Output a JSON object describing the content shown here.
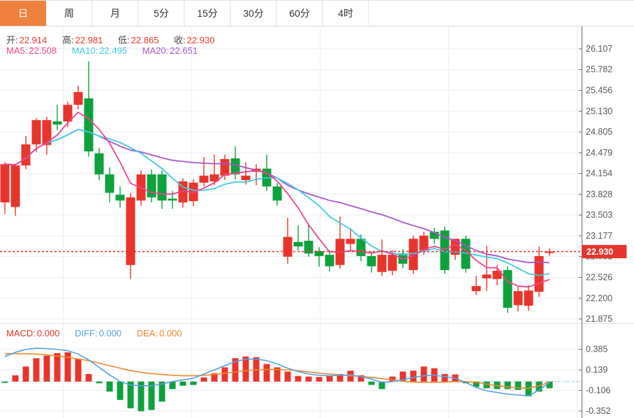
{
  "header_tabs": {
    "items": [
      {
        "label": "日",
        "active": true
      },
      {
        "label": "周",
        "active": false
      },
      {
        "label": "月",
        "active": false
      },
      {
        "label": "5分",
        "active": false
      },
      {
        "label": "15分",
        "active": false
      },
      {
        "label": "30分",
        "active": false
      },
      {
        "label": "60分",
        "active": false
      },
      {
        "label": "4时",
        "active": false
      }
    ]
  },
  "quote_bar": {
    "open_label": "开:",
    "open_value": "22.914",
    "high_label": "高:",
    "high_value": "22.981",
    "low_label": "低:",
    "low_value": "22.865",
    "close_label": "收:",
    "close_value": "22.930"
  },
  "ma_bar": {
    "ma5_label": "MA5:",
    "ma5_value": "22.508",
    "ma10_label": "MA10:",
    "ma10_value": "22.495",
    "ma20_label": "MA20:",
    "ma20_value": "22.651"
  },
  "macd_bar": {
    "macd_label": "MACD:",
    "macd_value": "0.000",
    "diff_label": "DIFF:",
    "diff_value": "0.000",
    "dea_label": "DEA:",
    "dea_value": "0.000"
  },
  "price_marker": {
    "value": "22.930"
  },
  "colors": {
    "up": "#e8352c",
    "down": "#0ea13c",
    "ma5": "#f2418f",
    "ma10": "#3fcbe0",
    "ma20": "#aa55cc",
    "diff": "#55a0e6",
    "dea": "#f0872a",
    "tab_active": "#ef813c",
    "grid": "#e9eef4",
    "axis": "#666666",
    "marker": "#f5222d",
    "tick_text": "#555555",
    "zero_dash": "#c9d1db",
    "zero_dot": "#a9d9f6"
  },
  "chart_data": {
    "type": "candlestick",
    "title": "",
    "main_pane": {
      "y_ticks": [
        26.107,
        25.782,
        25.456,
        25.13,
        24.805,
        24.479,
        24.154,
        23.828,
        23.503,
        23.177,
        22.851,
        22.526,
        22.2,
        21.875
      ],
      "current_price": 22.93,
      "ma_periods": [
        5,
        10,
        20
      ],
      "candles_ohlc": [
        [
          23.7,
          24.33,
          23.52,
          24.3
        ],
        [
          23.63,
          24.31,
          23.49,
          24.28
        ],
        [
          24.28,
          24.74,
          24.22,
          24.61
        ],
        [
          24.61,
          25.02,
          24.49,
          24.99
        ],
        [
          24.6,
          25.04,
          24.45,
          24.99
        ],
        [
          24.97,
          25.23,
          24.83,
          24.92
        ],
        [
          24.97,
          25.28,
          24.88,
          25.23
        ],
        [
          25.23,
          25.53,
          25.16,
          25.43
        ],
        [
          25.33,
          25.91,
          24.42,
          24.5
        ],
        [
          24.47,
          24.55,
          24.05,
          24.14
        ],
        [
          24.14,
          24.25,
          23.7,
          23.85
        ],
        [
          23.82,
          23.95,
          23.62,
          23.73
        ],
        [
          22.72,
          23.85,
          22.5,
          23.78
        ],
        [
          23.73,
          24.2,
          23.65,
          24.14
        ],
        [
          24.14,
          24.22,
          23.7,
          23.78
        ],
        [
          24.14,
          24.2,
          23.6,
          23.73
        ],
        [
          23.76,
          23.88,
          23.6,
          23.73
        ],
        [
          23.7,
          24.08,
          23.62,
          24.03
        ],
        [
          23.72,
          24.06,
          23.64,
          24.01
        ],
        [
          24.01,
          24.41,
          23.95,
          24.12
        ],
        [
          24.03,
          24.45,
          23.97,
          24.14
        ],
        [
          24.12,
          24.45,
          24.05,
          24.38
        ],
        [
          24.39,
          24.58,
          24.06,
          24.14
        ],
        [
          24.05,
          24.33,
          23.98,
          24.12
        ],
        [
          24.18,
          24.3,
          23.97,
          24.23
        ],
        [
          24.23,
          24.45,
          23.88,
          23.95
        ],
        [
          23.95,
          24.0,
          23.65,
          23.73
        ],
        [
          22.85,
          23.46,
          22.74,
          23.16
        ],
        [
          23.08,
          23.34,
          22.95,
          23.01
        ],
        [
          23.1,
          23.34,
          22.85,
          22.9
        ],
        [
          22.94,
          23.0,
          22.69,
          22.86
        ],
        [
          22.88,
          22.95,
          22.62,
          22.7
        ],
        [
          22.72,
          23.48,
          22.66,
          23.13
        ],
        [
          23.05,
          23.3,
          22.95,
          23.13
        ],
        [
          23.13,
          23.2,
          22.78,
          22.86
        ],
        [
          22.86,
          22.93,
          22.6,
          22.7
        ],
        [
          22.61,
          23.12,
          22.55,
          22.88
        ],
        [
          22.63,
          22.95,
          22.56,
          22.88
        ],
        [
          22.9,
          22.97,
          22.67,
          22.74
        ],
        [
          22.64,
          23.18,
          22.58,
          23.13
        ],
        [
          22.95,
          23.24,
          22.88,
          23.18
        ],
        [
          23.24,
          23.3,
          23.05,
          23.13
        ],
        [
          23.26,
          23.32,
          22.58,
          22.64
        ],
        [
          22.88,
          23.13,
          22.8,
          23.13
        ],
        [
          23.13,
          23.18,
          22.6,
          22.66
        ],
        [
          22.31,
          22.55,
          22.25,
          22.39
        ],
        [
          22.51,
          23.02,
          22.31,
          22.57
        ],
        [
          22.5,
          22.72,
          22.4,
          22.63
        ],
        [
          22.64,
          22.7,
          21.97,
          22.05
        ],
        [
          22.09,
          22.38,
          21.99,
          22.31
        ],
        [
          22.08,
          22.4,
          22.0,
          22.32
        ],
        [
          22.3,
          23.01,
          22.22,
          22.86
        ],
        [
          22.914,
          22.981,
          22.865,
          22.93
        ]
      ]
    },
    "macd_pane": {
      "y_ticks": [
        0.385,
        0.139,
        -0.106,
        -0.352
      ],
      "histogram": [
        -0.015,
        0.075,
        0.18,
        0.28,
        0.31,
        0.34,
        0.35,
        0.27,
        0.09,
        -0.02,
        -0.12,
        -0.22,
        -0.32,
        -0.355,
        -0.34,
        -0.24,
        -0.09,
        -0.05,
        -0.04,
        0.05,
        0.1,
        0.17,
        0.28,
        0.3,
        0.29,
        0.21,
        0.17,
        0.12,
        0.067,
        0.06,
        0.055,
        0.067,
        0.09,
        0.13,
        0.075,
        -0.04,
        -0.09,
        0.06,
        0.12,
        0.13,
        0.18,
        0.16,
        0.09,
        0.085,
        -0.02,
        -0.065,
        -0.08,
        -0.09,
        -0.09,
        -0.1,
        -0.175,
        -0.12,
        -0.08
      ],
      "diff": [
        0.3,
        0.35,
        0.385,
        0.4,
        0.395,
        0.385,
        0.37,
        0.33,
        0.26,
        0.17,
        0.08,
        0.0,
        -0.04,
        -0.05,
        -0.05,
        -0.03,
        0.0,
        0.02,
        0.04,
        0.09,
        0.14,
        0.19,
        0.24,
        0.265,
        0.27,
        0.25,
        0.21,
        0.16,
        0.12,
        0.09,
        0.075,
        0.07,
        0.075,
        0.08,
        0.06,
        0.03,
        -0.01,
        0.0,
        0.02,
        0.05,
        0.07,
        0.075,
        0.06,
        0.04,
        -0.01,
        -0.07,
        -0.11,
        -0.13,
        -0.15,
        -0.16,
        -0.17,
        -0.1,
        -0.01
      ],
      "dea": [
        0.33,
        0.335,
        0.335,
        0.33,
        0.32,
        0.305,
        0.29,
        0.27,
        0.25,
        0.22,
        0.19,
        0.16,
        0.13,
        0.11,
        0.095,
        0.085,
        0.075,
        0.07,
        0.07,
        0.075,
        0.085,
        0.1,
        0.115,
        0.13,
        0.14,
        0.145,
        0.145,
        0.14,
        0.13,
        0.115,
        0.1,
        0.09,
        0.08,
        0.07,
        0.06,
        0.05,
        0.035,
        0.02,
        0.005,
        -0.005,
        -0.01,
        -0.01,
        -0.005,
        0.0,
        0.0,
        -0.01,
        -0.03,
        -0.05,
        -0.065,
        -0.075,
        -0.08,
        -0.05,
        -0.005
      ]
    }
  }
}
